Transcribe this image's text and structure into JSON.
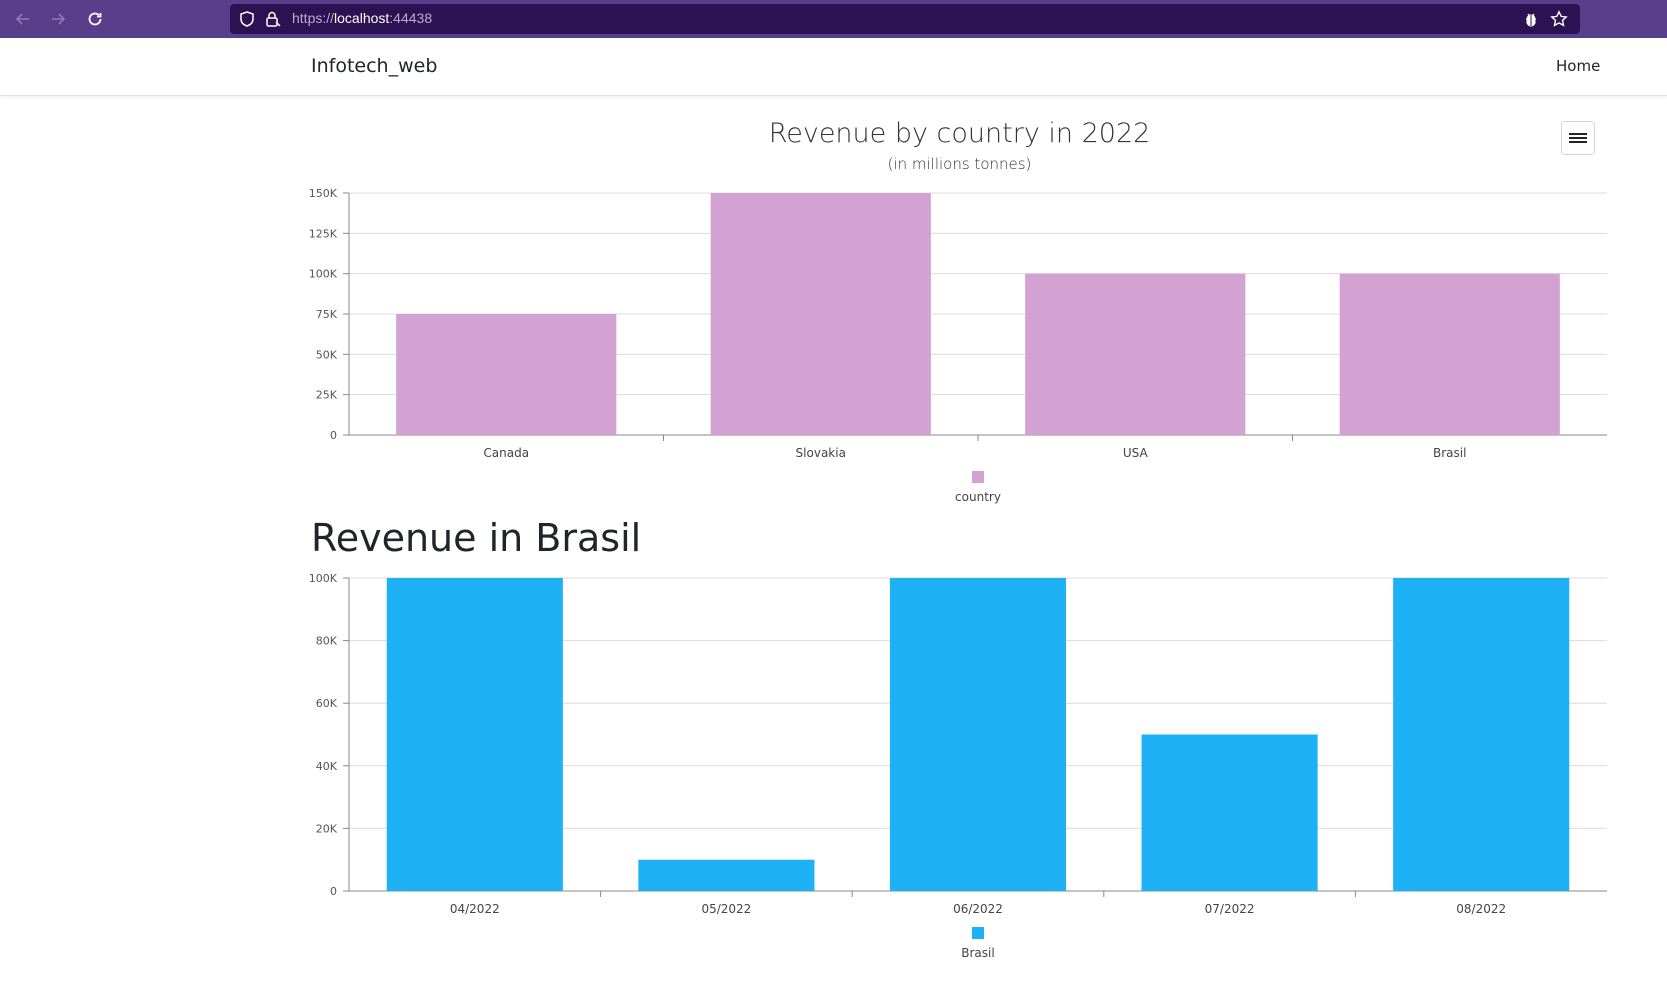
{
  "browser": {
    "url_scheme": "https://",
    "url_host": "localhost",
    "url_port": ":44438"
  },
  "navbar": {
    "brand": "Infotech_web",
    "home_label": "Home"
  },
  "chart1": {
    "menu_icon": "hamburger-icon"
  },
  "section": {
    "heading": "Revenue in Brasil"
  },
  "colors": {
    "browser_chrome": "#5a3e8c",
    "url_bar": "#2c1252",
    "bar_country": "#d1a2d2",
    "bar_brasil": "#1eb1f5"
  },
  "chart_data": [
    {
      "type": "bar",
      "title": "Revenue by country in 2022",
      "subtitle": "(in millions tonnes)",
      "categories": [
        "Canada",
        "Slovakia",
        "USA",
        "Brasil"
      ],
      "series": [
        {
          "name": "country",
          "values": [
            75000,
            150000,
            100000,
            100000
          ]
        }
      ],
      "ylim": [
        0,
        150000
      ],
      "yticks": [
        0,
        25000,
        50000,
        75000,
        100000,
        125000,
        150000
      ],
      "ytick_labels": [
        "0",
        "25K",
        "50K",
        "75K",
        "100K",
        "125K",
        "150K"
      ],
      "grid": true,
      "legend": "bottom-center",
      "color": "#d1a2d2"
    },
    {
      "type": "bar",
      "title": "",
      "categories": [
        "04/2022",
        "05/2022",
        "06/2022",
        "07/2022",
        "08/2022"
      ],
      "series": [
        {
          "name": "Brasil",
          "values": [
            100000,
            10000,
            100000,
            50000,
            100000
          ]
        }
      ],
      "ylim": [
        0,
        100000
      ],
      "yticks": [
        0,
        20000,
        40000,
        60000,
        80000,
        100000
      ],
      "ytick_labels": [
        "0",
        "20K",
        "40K",
        "60K",
        "80K",
        "100K"
      ],
      "grid": true,
      "legend": "bottom-center",
      "color": "#1eb1f5"
    }
  ]
}
